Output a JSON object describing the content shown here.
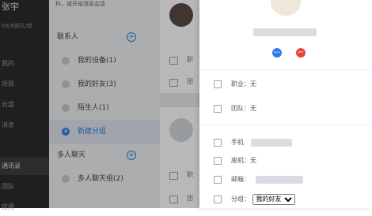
{
  "user": {
    "name": "张宇",
    "subtitle": "b9/8部队/新"
  },
  "nav": {
    "items": [
      {
        "label": "我的"
      },
      {
        "label": "项目"
      },
      {
        "label": "云盘"
      },
      {
        "label": "消息"
      },
      {
        "label": "通讯录"
      },
      {
        "label": "团队"
      },
      {
        "label": "应用"
      }
    ]
  },
  "contacts": {
    "hint": "科，或开始消息会话",
    "section_contacts": "联系人",
    "items": [
      {
        "label": "我的设备(1)"
      },
      {
        "label": "我的好友(3)"
      },
      {
        "label": "陌生人(1)"
      }
    ],
    "new_group": "新建分组",
    "section_group": "多人聊天",
    "group_items": [
      {
        "label": "多人聊天组(2)"
      }
    ],
    "plus_glyph": "+"
  },
  "middle": {
    "row_label_1": "职",
    "row_label_2": "团",
    "row_label_3": "职",
    "row_label_4": "团"
  },
  "detail": {
    "actions": {
      "message_glyph": "•••",
      "remove_glyph": "−"
    },
    "rows": {
      "job": "职业：无",
      "team": "团队：无",
      "phone": "手机",
      "landline": "座机：无",
      "email": "邮箱：",
      "group": "分组："
    },
    "group_select": {
      "selected": "我的好友"
    }
  },
  "colors": {
    "accent": "#2f7ce8",
    "danger": "#e8453c",
    "nav_bg": "#2c2c2c"
  }
}
